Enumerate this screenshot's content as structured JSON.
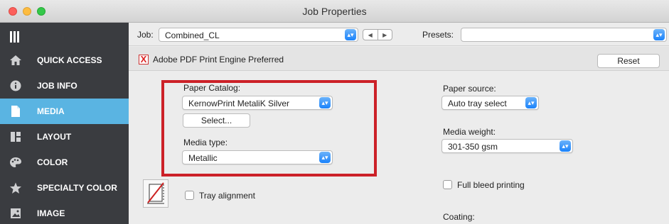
{
  "window": {
    "title": "Job Properties"
  },
  "sidebar": {
    "items": [
      {
        "label": "QUICK ACCESS",
        "icon": "home-icon"
      },
      {
        "label": "JOB INFO",
        "icon": "info-icon"
      },
      {
        "label": "MEDIA",
        "icon": "page-icon",
        "active": true
      },
      {
        "label": "LAYOUT",
        "icon": "layout-icon"
      },
      {
        "label": "COLOR",
        "icon": "palette-icon"
      },
      {
        "label": "SPECIALTY COLOR",
        "icon": "star-icon"
      },
      {
        "label": "IMAGE",
        "icon": "image-icon"
      }
    ]
  },
  "jobrow": {
    "job_label": "Job:",
    "job_value": "Combined_CL",
    "presets_label": "Presets:",
    "presets_value": ""
  },
  "prefrow": {
    "mark": "X",
    "label": "Adobe PDF Print Engine Preferred",
    "reset_label": "Reset"
  },
  "media": {
    "paper_catalog_label": "Paper Catalog:",
    "paper_catalog_value": "KernowPrint MetaliK Silver",
    "select_button_label": "Select...",
    "media_type_label": "Media type:",
    "media_type_value": "Metallic",
    "tray_alignment_label": "Tray alignment",
    "paper_source_label": "Paper source:",
    "paper_source_value": "Auto tray select",
    "media_weight_label": "Media weight:",
    "media_weight_value": "301-350 gsm",
    "full_bleed_label": "Full bleed printing",
    "coating_label": "Coating:"
  },
  "colors": {
    "sidebar_bg": "#3a3c40",
    "active_item": "#5ab4e2",
    "highlight_box": "#cc2128",
    "select_arrows": "#1a82fb"
  }
}
